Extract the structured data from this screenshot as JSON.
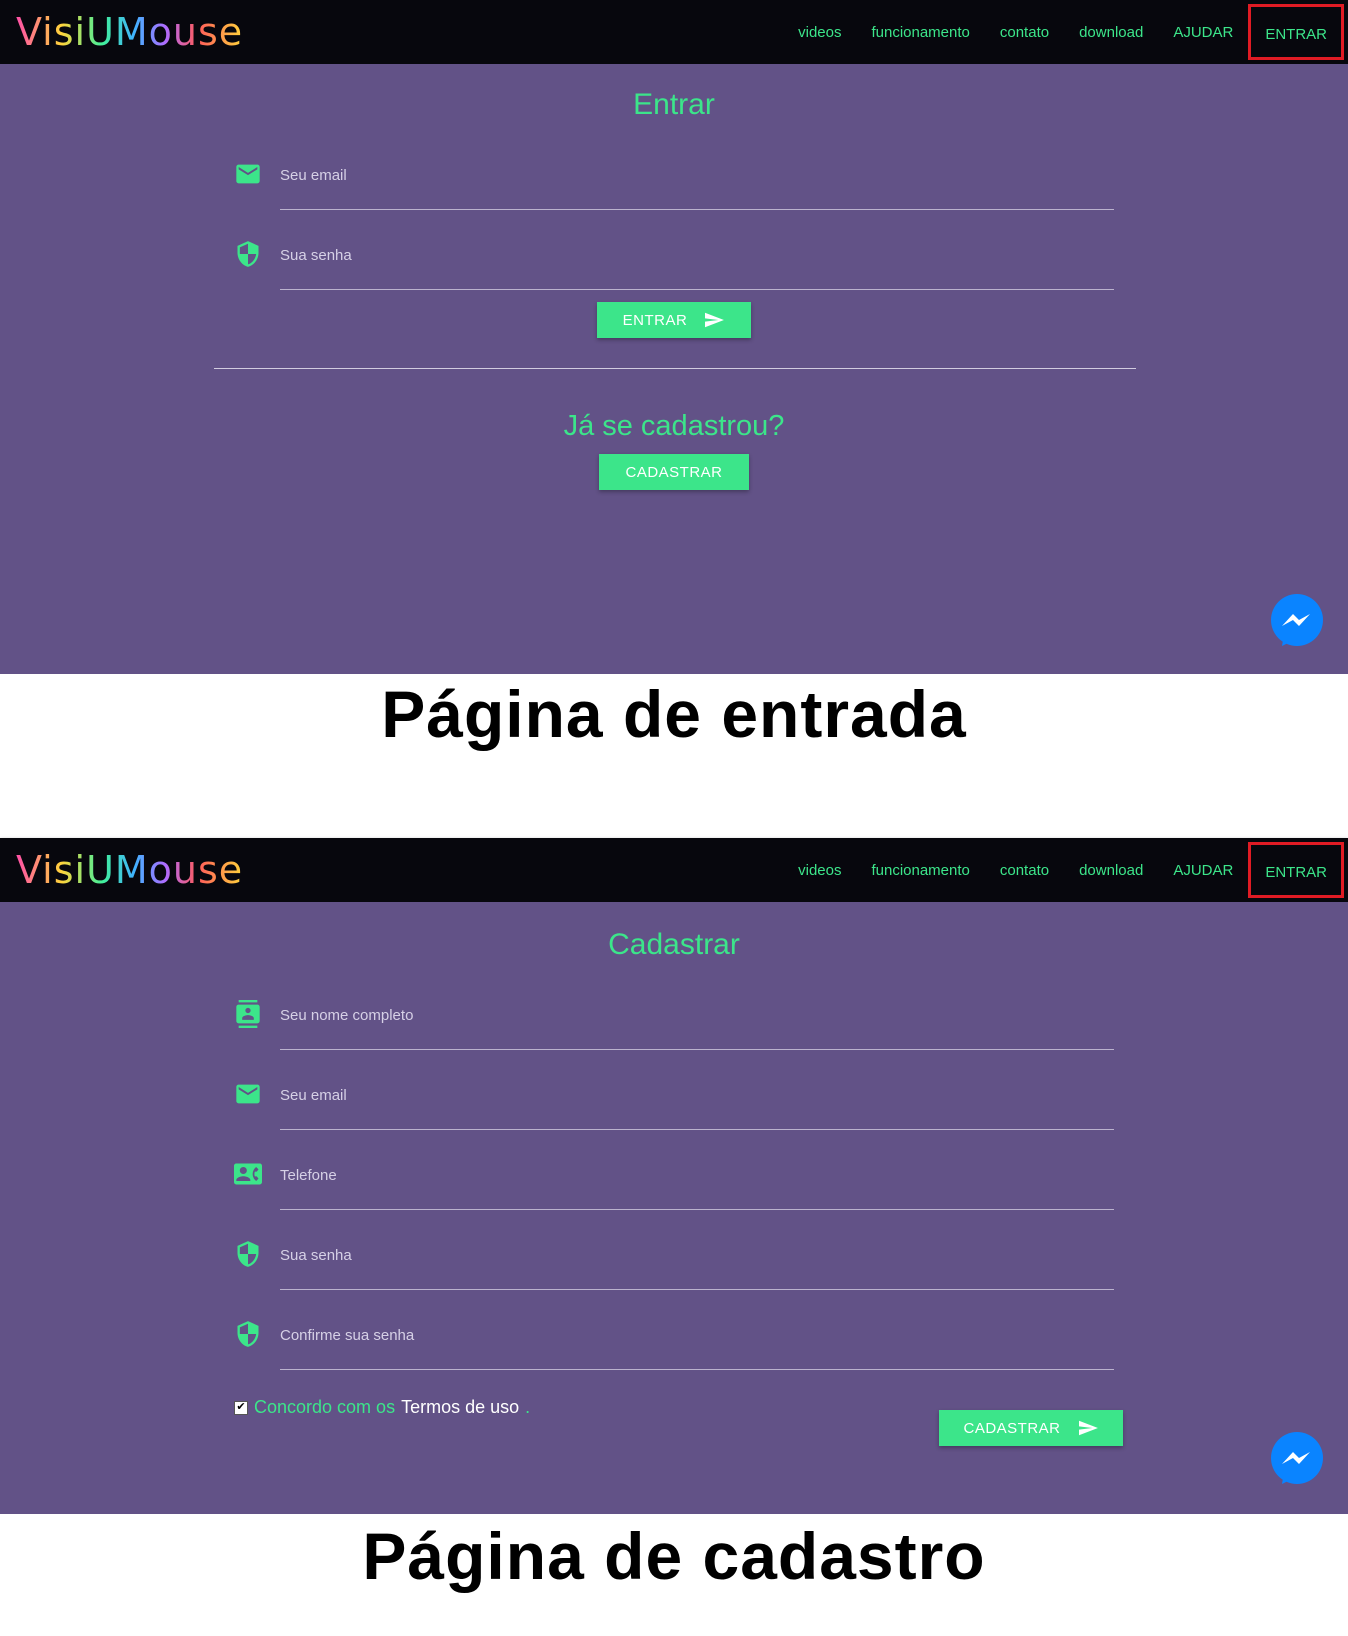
{
  "nav": {
    "logo": "VisiUMouse",
    "links": [
      "videos",
      "funcionamento",
      "contato",
      "download",
      "AJUDAR",
      "ENTRAR"
    ]
  },
  "login": {
    "title": "Entrar",
    "email_placeholder": "Seu email",
    "password_placeholder": "Sua senha",
    "submit_label": "ENTRAR",
    "registered_question": "Já se cadastrou?",
    "register_button": "CADASTRAR",
    "caption": "Página de entrada"
  },
  "register": {
    "title": "Cadastrar",
    "name_placeholder": "Seu nome completo",
    "email_placeholder": "Seu email",
    "phone_placeholder": "Telefone",
    "password_placeholder": "Sua senha",
    "confirm_placeholder": "Confirme sua senha",
    "terms_prefix": "Concordo com os",
    "terms_link": "Termos de uso",
    "terms_suffix": ".",
    "submit_label": "CADASTRAR",
    "caption": "Página de cadastro"
  },
  "colors": {
    "accent": "#3ce58a",
    "navbar": "#07070d",
    "content_bg": "#625287",
    "highlight_border": "#e01b24",
    "messenger": "#0a84ff"
  }
}
